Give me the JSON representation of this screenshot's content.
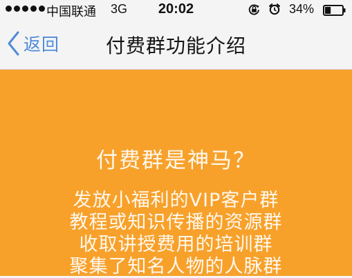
{
  "status_bar": {
    "carrier": "中国联通",
    "network": "3G",
    "time": "20:02",
    "battery_percent": "34%",
    "battery_level": 0.34,
    "icons": [
      "signal-dots",
      "rotation-lock-icon",
      "alarm-icon",
      "battery-icon"
    ]
  },
  "nav": {
    "back_label": "返回",
    "title": "付费群功能介绍",
    "accent_color": "#4f8bd6"
  },
  "content": {
    "background_color": "#f7a12b",
    "question": "付费群是神马？",
    "features": [
      "发放小福利的VIP客户群",
      "教程或知识传播的资源群",
      "收取讲授费用的培训群",
      "聚集了知名人物的人脉群"
    ]
  }
}
